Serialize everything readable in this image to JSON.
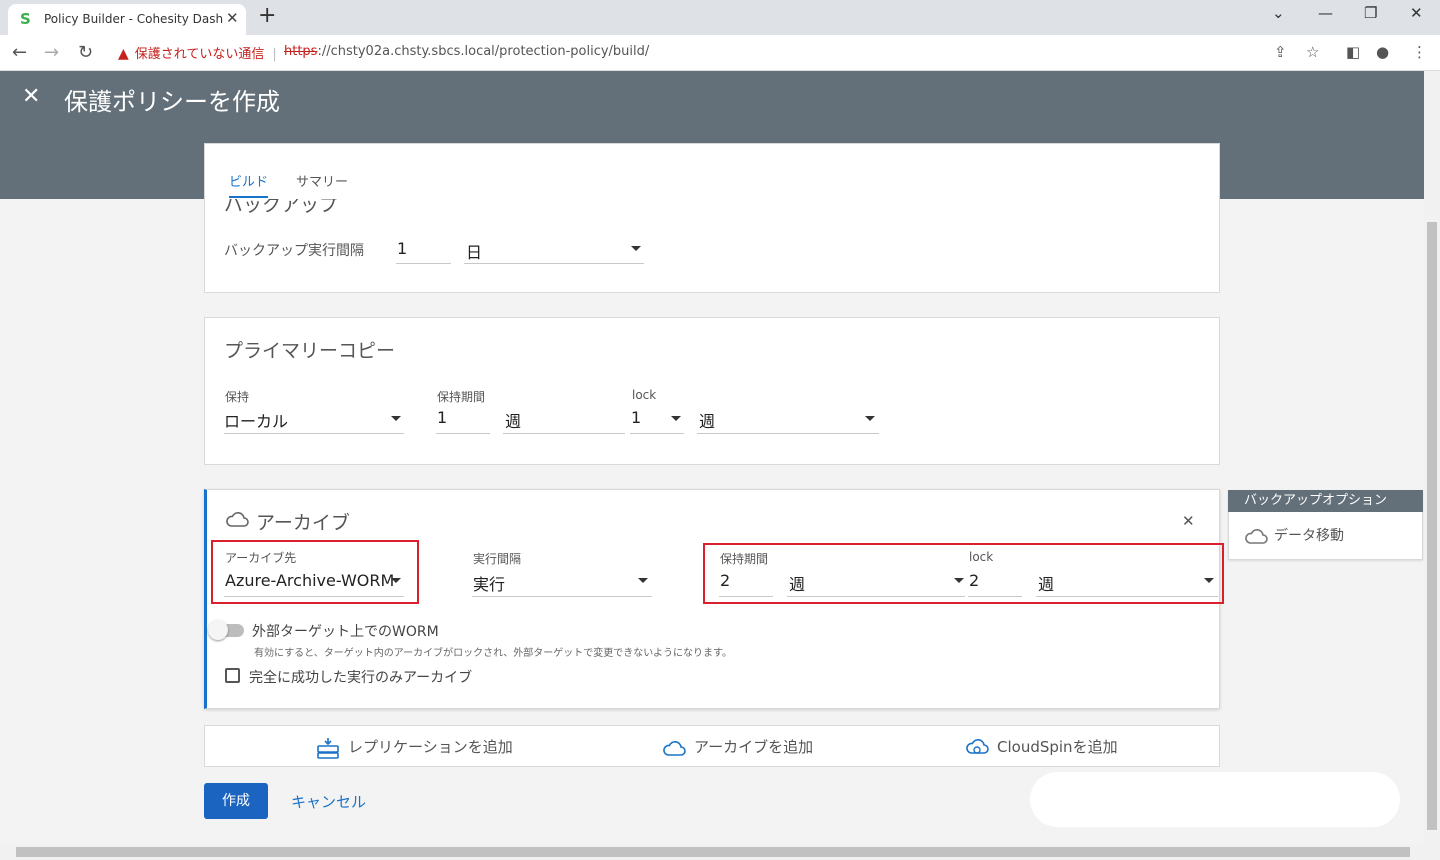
{
  "browser": {
    "tab_title": "Policy Builder - Cohesity Dashboard",
    "insecure_label": "保護されていない通信",
    "url_scheme": "https",
    "url_rest": "://chsty02a.chsty.sbcs.local/protection-policy/build/"
  },
  "header": {
    "title": "保護ポリシーを作成"
  },
  "tabs": [
    {
      "label": "ビルド",
      "active": true
    },
    {
      "label": "サマリー",
      "active": false
    }
  ],
  "backup": {
    "section_title": "バックアップ",
    "interval_label": "バックアップ実行間隔",
    "interval_value": "1",
    "interval_unit": "日"
  },
  "primary_copy": {
    "title": "プライマリーコピー",
    "retain_label": "保持",
    "retain_value": "ローカル",
    "period_label": "保持期間",
    "period_value": "1",
    "period_unit": "週",
    "lock_label": "lock",
    "lock_value": "1",
    "lock_unit": "週"
  },
  "archive": {
    "title": "アーカイブ",
    "dest_label": "アーカイブ先",
    "dest_value": "Azure-Archive-WORM",
    "interval_label": "実行間隔",
    "interval_value": "実行",
    "period_label": "保持期間",
    "period_value": "2",
    "period_unit": "週",
    "lock_label": "lock",
    "lock_value": "2",
    "lock_unit": "週",
    "worm_label": "外部ターゲット上でのWORM",
    "worm_desc": "有効にすると、ターゲット内のアーカイブがロックされ、外部ターゲットで変更できないようになります。",
    "worm_enabled": false,
    "success_only_label": "完全に成功した実行のみアーカイブ",
    "success_only_checked": false
  },
  "actions": {
    "add_replication": "レプリケーションを追加",
    "add_archive": "アーカイブを追加",
    "add_cloudspin": "CloudSpinを追加"
  },
  "buttons": {
    "create": "作成",
    "cancel": "キャンセル"
  },
  "side_panel": {
    "title": "バックアップオプション",
    "item": "データ移動"
  },
  "colors": {
    "header_bg": "#637079",
    "accent": "#1a73c8",
    "primary_button": "#1b64c0",
    "highlight_border": "#d9202d"
  }
}
